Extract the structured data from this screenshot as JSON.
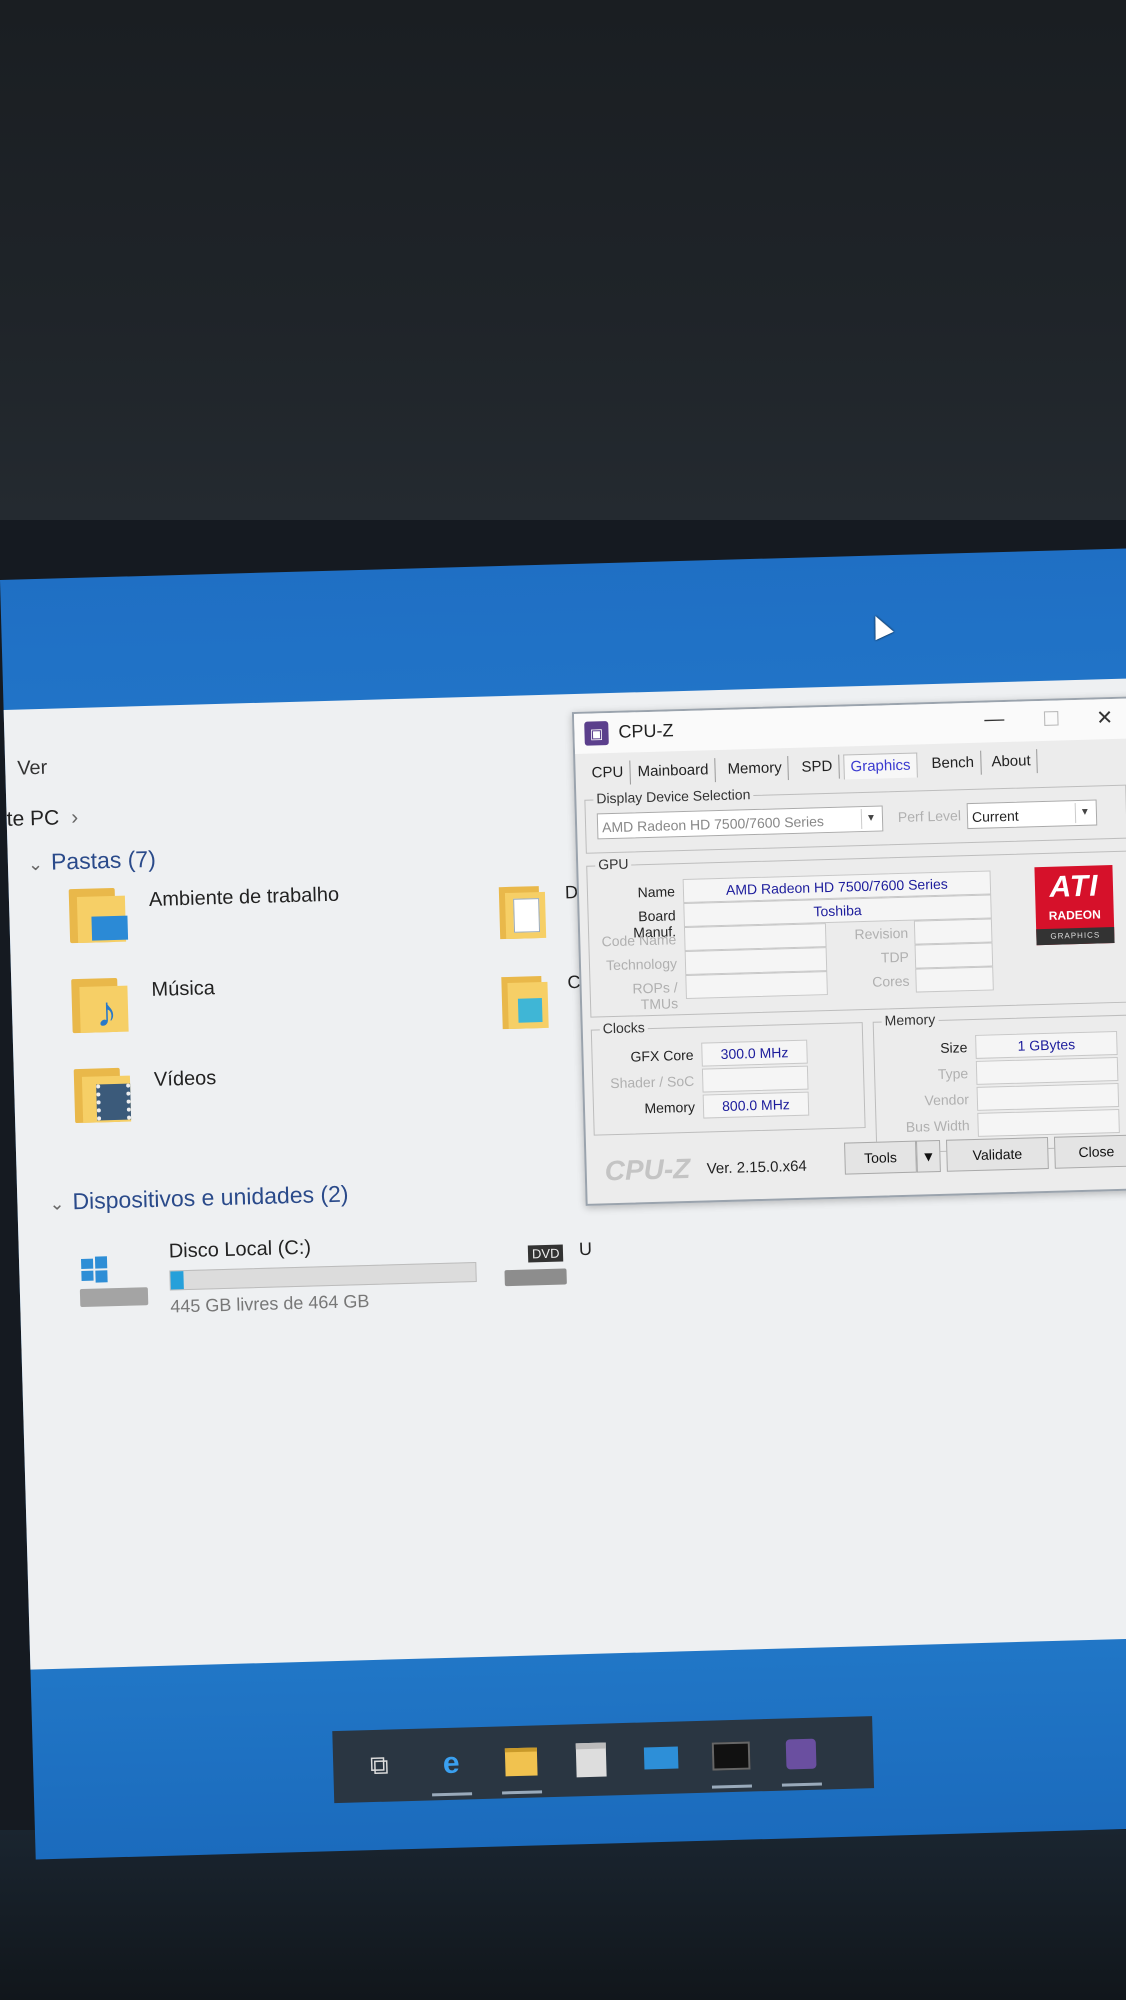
{
  "explorer": {
    "menu": "Ver",
    "path": "te PC",
    "folders_header": "Pastas (7)",
    "folders": [
      {
        "label": "Ambiente de trabalho",
        "icon": "desktop-folder-icon"
      },
      {
        "label": "Música",
        "icon": "music-folder-icon"
      },
      {
        "label": "Vídeos",
        "icon": "videos-folder-icon"
      }
    ],
    "side_letter_1": "D",
    "side_letter_2": "C",
    "devices_header": "Dispositivos e unidades (2)",
    "disk": {
      "name": "Disco Local (C:)",
      "free": "445 GB livres de 464 GB",
      "used_fraction": 0.041
    },
    "dvd_label": "DVD",
    "dvd_letter": "U"
  },
  "cpuz": {
    "title": "CPU-Z",
    "tabs": [
      "CPU",
      "Mainboard",
      "Memory",
      "SPD",
      "Graphics",
      "Bench",
      "About"
    ],
    "selected_tab": "Graphics",
    "display_device_selection": "Display Device Selection",
    "device": "AMD Radeon HD 7500/7600 Series",
    "perf_level_label": "Perf Level",
    "perf_level": "Current",
    "gpu": {
      "group": "GPU",
      "name_label": "Name",
      "name": "AMD Radeon HD 7500/7600 Series",
      "board_label": "Board Manuf.",
      "board": "Toshiba",
      "code_name_label": "Code Name",
      "revision_label": "Revision",
      "technology_label": "Technology",
      "tdp_label": "TDP",
      "rops_label": "ROPs / TMUs",
      "cores_label": "Cores"
    },
    "logo": {
      "brand": "ATI",
      "sub": "RADEON",
      "tag": "GRAPHICS"
    },
    "clocks": {
      "group": "Clocks",
      "gfx_label": "GFX Core",
      "gfx": "300.0 MHz",
      "shader_label": "Shader / SoC",
      "memory_label": "Memory",
      "memory": "800.0 MHz"
    },
    "memory": {
      "group": "Memory",
      "size_label": "Size",
      "size": "1 GBytes",
      "type_label": "Type",
      "vendor_label": "Vendor",
      "bus_label": "Bus Width"
    },
    "footer": {
      "brand": "CPU-Z",
      "version": "Ver. 2.15.0.x64",
      "tools": "Tools",
      "validate": "Validate",
      "close": "Close"
    }
  },
  "taskbar": {
    "icons": [
      "task-view-icon",
      "edge-icon",
      "file-explorer-icon",
      "store-icon",
      "mail-icon",
      "terminal-icon",
      "cpuz-icon"
    ]
  },
  "colors": {
    "accent": "#26a0da",
    "wallpaper": "#2b8ad6",
    "ati_red": "#d6112a",
    "selected_tab": "#3a3ad0"
  }
}
